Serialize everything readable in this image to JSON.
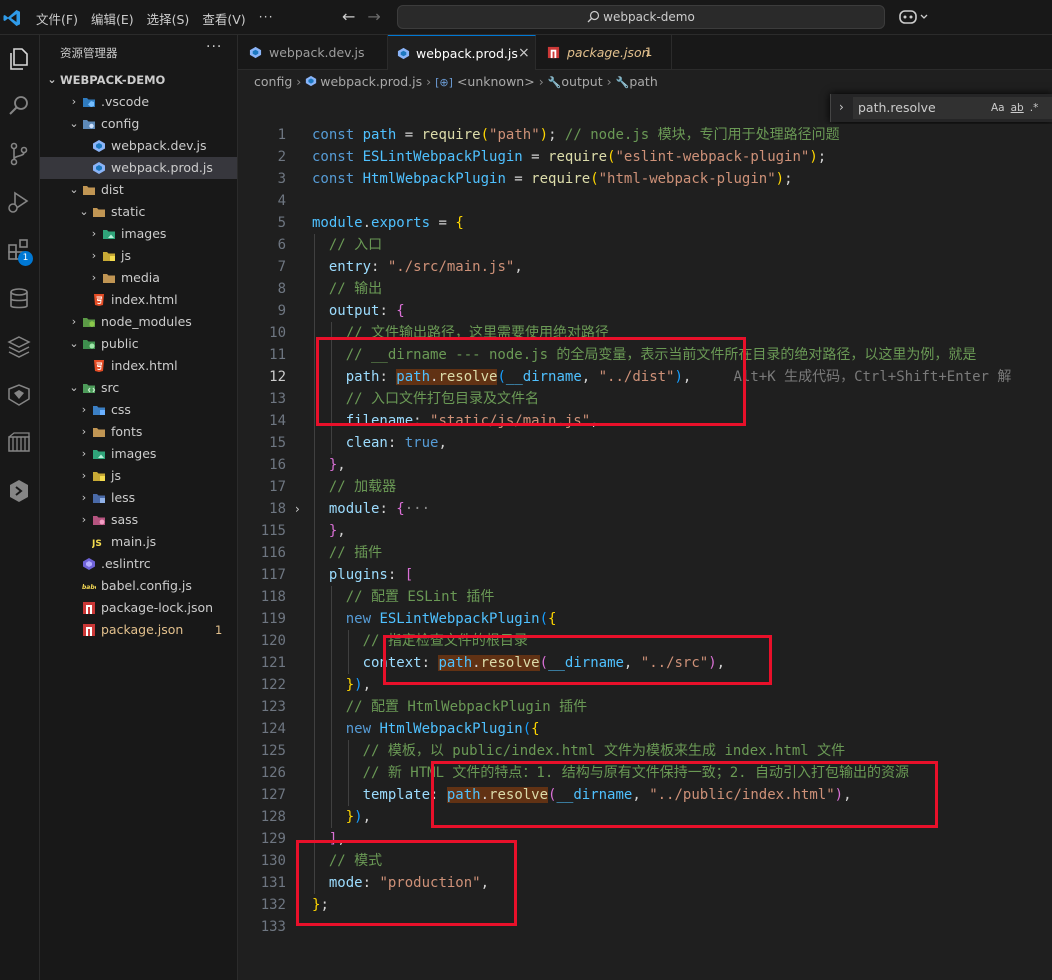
{
  "titlebar": {
    "menu": [
      "文件(F)",
      "编辑(E)",
      "选择(S)",
      "查看(V)"
    ],
    "more": "···",
    "search": "webpack-demo"
  },
  "sidebar": {
    "title": "资源管理器",
    "more": "···",
    "root": "WEBPACK-DEMO",
    "items": [
      {
        "label": ".vscode",
        "depth": 1,
        "chev": "›",
        "icon": "vscode-folder-icon"
      },
      {
        "label": "config",
        "depth": 1,
        "chev": "⌄",
        "icon": "config-folder-icon"
      },
      {
        "label": "webpack.dev.js",
        "depth": 2,
        "chev": "",
        "icon": "webpack-icon"
      },
      {
        "label": "webpack.prod.js",
        "depth": 2,
        "chev": "",
        "icon": "webpack-icon",
        "selected": true
      },
      {
        "label": "dist",
        "depth": 1,
        "chev": "⌄",
        "icon": "folder-icon"
      },
      {
        "label": "static",
        "depth": 2,
        "chev": "⌄",
        "icon": "folder-icon"
      },
      {
        "label": "images",
        "depth": 3,
        "chev": "›",
        "icon": "images-folder-icon"
      },
      {
        "label": "js",
        "depth": 3,
        "chev": "›",
        "icon": "js-folder-icon"
      },
      {
        "label": "media",
        "depth": 3,
        "chev": "›",
        "icon": "folder-icon"
      },
      {
        "label": "index.html",
        "depth": 2,
        "chev": "",
        "icon": "html-icon"
      },
      {
        "label": "node_modules",
        "depth": 1,
        "chev": "›",
        "icon": "node-folder-icon"
      },
      {
        "label": "public",
        "depth": 1,
        "chev": "⌄",
        "icon": "public-folder-icon"
      },
      {
        "label": "index.html",
        "depth": 2,
        "chev": "",
        "icon": "html-icon"
      },
      {
        "label": "src",
        "depth": 1,
        "chev": "⌄",
        "icon": "src-folder-icon"
      },
      {
        "label": "css",
        "depth": 2,
        "chev": "›",
        "icon": "css-folder-icon"
      },
      {
        "label": "fonts",
        "depth": 2,
        "chev": "›",
        "icon": "folder-icon"
      },
      {
        "label": "images",
        "depth": 2,
        "chev": "›",
        "icon": "images-folder-icon"
      },
      {
        "label": "js",
        "depth": 2,
        "chev": "›",
        "icon": "js-folder-icon"
      },
      {
        "label": "less",
        "depth": 2,
        "chev": "›",
        "icon": "less-folder-icon"
      },
      {
        "label": "sass",
        "depth": 2,
        "chev": "›",
        "icon": "sass-folder-icon"
      },
      {
        "label": "main.js",
        "depth": 2,
        "chev": "",
        "icon": "js-file-icon"
      },
      {
        "label": ".eslintrc",
        "depth": 1,
        "chev": "",
        "icon": "eslint-icon"
      },
      {
        "label": "babel.config.js",
        "depth": 1,
        "chev": "",
        "icon": "babel-icon"
      },
      {
        "label": "package-lock.json",
        "depth": 1,
        "chev": "",
        "icon": "npm-icon"
      },
      {
        "label": "package.json",
        "depth": 1,
        "chev": "",
        "icon": "npm-icon",
        "modified": true,
        "count": "1"
      }
    ]
  },
  "tabs": [
    {
      "label": "webpack.dev.js",
      "active": false
    },
    {
      "label": "webpack.prod.js",
      "active": true,
      "close": "×"
    },
    {
      "label": "package.json",
      "active": false,
      "modified": true,
      "count": "1"
    }
  ],
  "breadcrumb": [
    "config",
    "webpack.prod.js",
    "<unknown>",
    "output",
    "path"
  ],
  "find": {
    "value": "path.resolve",
    "options": [
      "Aa",
      "ab",
      ".*"
    ]
  },
  "code": [
    {
      "n": "1",
      "t": [
        [
          "kw",
          "const "
        ],
        [
          "var",
          "path"
        ],
        [
          "op",
          " = "
        ],
        [
          "fn",
          "require"
        ],
        [
          "br1",
          "("
        ],
        [
          "str",
          "\"path\""
        ],
        [
          "br1",
          ")"
        ],
        [
          "op",
          "; "
        ],
        [
          "cm",
          "// node.js 模块，专门用于处理路径问题"
        ]
      ]
    },
    {
      "n": "2",
      "t": [
        [
          "kw",
          "const "
        ],
        [
          "var",
          "ESLintWebpackPlugin"
        ],
        [
          "op",
          " = "
        ],
        [
          "fn",
          "require"
        ],
        [
          "br1",
          "("
        ],
        [
          "str",
          "\"eslint-webpack-plugin\""
        ],
        [
          "br1",
          ")"
        ],
        [
          "op",
          ";"
        ]
      ]
    },
    {
      "n": "3",
      "t": [
        [
          "kw",
          "const "
        ],
        [
          "var",
          "HtmlWebpackPlugin"
        ],
        [
          "op",
          " = "
        ],
        [
          "fn",
          "require"
        ],
        [
          "br1",
          "("
        ],
        [
          "str",
          "\"html-webpack-plugin\""
        ],
        [
          "br1",
          ")"
        ],
        [
          "op",
          ";"
        ]
      ]
    },
    {
      "n": "4",
      "t": []
    },
    {
      "n": "5",
      "t": [
        [
          "var",
          "module"
        ],
        [
          "op",
          "."
        ],
        [
          "var",
          "exports"
        ],
        [
          "op",
          " = "
        ],
        [
          "br1",
          "{"
        ]
      ]
    },
    {
      "n": "6",
      "t": [
        [
          "op",
          "  "
        ],
        [
          "cm",
          "// 入口"
        ]
      ]
    },
    {
      "n": "7",
      "t": [
        [
          "op",
          "  "
        ],
        [
          "prop",
          "entry"
        ],
        [
          "op",
          ": "
        ],
        [
          "str",
          "\"./src/main.js\""
        ],
        [
          "op",
          ","
        ]
      ]
    },
    {
      "n": "8",
      "t": [
        [
          "op",
          "  "
        ],
        [
          "cm",
          "// 输出"
        ]
      ]
    },
    {
      "n": "9",
      "t": [
        [
          "op",
          "  "
        ],
        [
          "prop",
          "output"
        ],
        [
          "op",
          ": "
        ],
        [
          "br2",
          "{"
        ]
      ]
    },
    {
      "n": "10",
      "t": [
        [
          "op",
          "    "
        ],
        [
          "cm",
          "// 文件输出路径，这里需要使用绝对路径"
        ]
      ]
    },
    {
      "n": "11",
      "t": [
        [
          "op",
          "    "
        ],
        [
          "cm",
          "// __dirname --- node.js 的全局变量，表示当前文件所在目录的绝对路径，以这里为例，就是"
        ]
      ]
    },
    {
      "n": "12",
      "cur": true,
      "t": [
        [
          "op",
          "    "
        ],
        [
          "prop",
          "path"
        ],
        [
          "op",
          ": "
        ],
        [
          "hlvar",
          "path"
        ],
        [
          "hlop",
          "."
        ],
        [
          "hlfn",
          "resolve"
        ],
        [
          "br3",
          "("
        ],
        [
          "var",
          "__dirname"
        ],
        [
          "op",
          ", "
        ],
        [
          "str",
          "\"../dist\""
        ],
        [
          "br3",
          ")"
        ],
        [
          "op",
          ","
        ],
        [
          "hint",
          "     Alt+K 生成代码，Ctrl+Shift+Enter 解"
        ]
      ]
    },
    {
      "n": "13",
      "t": [
        [
          "op",
          "    "
        ],
        [
          "cm",
          "// 入口文件打包目录及文件名"
        ]
      ]
    },
    {
      "n": "14",
      "t": [
        [
          "op",
          "    "
        ],
        [
          "prop",
          "filename"
        ],
        [
          "op",
          ": "
        ],
        [
          "str",
          "\"static/js/main.js\""
        ],
        [
          "op",
          ","
        ]
      ]
    },
    {
      "n": "15",
      "t": [
        [
          "op",
          "    "
        ],
        [
          "prop",
          "clean"
        ],
        [
          "op",
          ": "
        ],
        [
          "kw",
          "true"
        ],
        [
          "op",
          ","
        ]
      ]
    },
    {
      "n": "16",
      "t": [
        [
          "op",
          "  "
        ],
        [
          "br2",
          "}"
        ],
        [
          "op",
          ","
        ]
      ]
    },
    {
      "n": "17",
      "t": [
        [
          "op",
          "  "
        ],
        [
          "cm",
          "// 加载器"
        ]
      ]
    },
    {
      "n": "18",
      "fold": true,
      "t": [
        [
          "op",
          "  "
        ],
        [
          "prop",
          "module"
        ],
        [
          "op",
          ": "
        ],
        [
          "br2",
          "{"
        ],
        [
          "ghost",
          "···"
        ]
      ]
    },
    {
      "n": "115",
      "t": [
        [
          "op",
          "  "
        ],
        [
          "br2",
          "}"
        ],
        [
          "op",
          ","
        ]
      ]
    },
    {
      "n": "116",
      "t": [
        [
          "op",
          "  "
        ],
        [
          "cm",
          "// 插件"
        ]
      ]
    },
    {
      "n": "117",
      "t": [
        [
          "op",
          "  "
        ],
        [
          "prop",
          "plugins"
        ],
        [
          "op",
          ": "
        ],
        [
          "br2",
          "["
        ]
      ]
    },
    {
      "n": "118",
      "t": [
        [
          "op",
          "    "
        ],
        [
          "cm",
          "// 配置 ESLint 插件"
        ]
      ]
    },
    {
      "n": "119",
      "t": [
        [
          "op",
          "    "
        ],
        [
          "kw",
          "new "
        ],
        [
          "var",
          "ESLintWebpackPlugin"
        ],
        [
          "br3",
          "("
        ],
        [
          "br1",
          "{"
        ]
      ]
    },
    {
      "n": "120",
      "t": [
        [
          "op",
          "      "
        ],
        [
          "cm",
          "// 指定检查文件的根目录"
        ]
      ]
    },
    {
      "n": "121",
      "t": [
        [
          "op",
          "      "
        ],
        [
          "prop",
          "context"
        ],
        [
          "op",
          ": "
        ],
        [
          "hlvar",
          "path"
        ],
        [
          "hlop",
          "."
        ],
        [
          "hlfn",
          "resolve"
        ],
        [
          "br2",
          "("
        ],
        [
          "var",
          "__dirname"
        ],
        [
          "op",
          ", "
        ],
        [
          "str",
          "\"../src\""
        ],
        [
          "br2",
          ")"
        ],
        [
          "op",
          ","
        ]
      ]
    },
    {
      "n": "122",
      "t": [
        [
          "op",
          "    "
        ],
        [
          "br1",
          "}"
        ],
        [
          "br3",
          ")"
        ],
        [
          "op",
          ","
        ]
      ]
    },
    {
      "n": "123",
      "t": [
        [
          "op",
          "    "
        ],
        [
          "cm",
          "// 配置 HtmlWebpackPlugin 插件"
        ]
      ]
    },
    {
      "n": "124",
      "t": [
        [
          "op",
          "    "
        ],
        [
          "kw",
          "new "
        ],
        [
          "var",
          "HtmlWebpackPlugin"
        ],
        [
          "br3",
          "("
        ],
        [
          "br1",
          "{"
        ]
      ]
    },
    {
      "n": "125",
      "t": [
        [
          "op",
          "      "
        ],
        [
          "cm",
          "// 模板，以 public/index.html 文件为模板来生成 index.html 文件"
        ]
      ]
    },
    {
      "n": "126",
      "t": [
        [
          "op",
          "      "
        ],
        [
          "cm",
          "// 新 HTML 文件的特点：1. 结构与原有文件保持一致；2. 自动引入打包输出的资源"
        ]
      ]
    },
    {
      "n": "127",
      "t": [
        [
          "op",
          "      "
        ],
        [
          "prop",
          "template"
        ],
        [
          "op",
          ": "
        ],
        [
          "hlvar",
          "path"
        ],
        [
          "hlop",
          "."
        ],
        [
          "hlfn",
          "resolve"
        ],
        [
          "br2",
          "("
        ],
        [
          "var",
          "__dirname"
        ],
        [
          "op",
          ", "
        ],
        [
          "str",
          "\"../public/index.html\""
        ],
        [
          "br2",
          ")"
        ],
        [
          "op",
          ","
        ]
      ]
    },
    {
      "n": "128",
      "t": [
        [
          "op",
          "    "
        ],
        [
          "br1",
          "}"
        ],
        [
          "br3",
          ")"
        ],
        [
          "op",
          ","
        ]
      ]
    },
    {
      "n": "129",
      "t": [
        [
          "op",
          "  "
        ],
        [
          "br2",
          "]"
        ],
        [
          "op",
          ","
        ]
      ]
    },
    {
      "n": "130",
      "t": [
        [
          "op",
          "  "
        ],
        [
          "cm",
          "// 模式"
        ]
      ]
    },
    {
      "n": "131",
      "t": [
        [
          "op",
          "  "
        ],
        [
          "prop",
          "mode"
        ],
        [
          "op",
          ": "
        ],
        [
          "str",
          "\"production\""
        ],
        [
          "op",
          ","
        ]
      ]
    },
    {
      "n": "132",
      "t": [
        [
          "br1",
          "}"
        ],
        [
          "op",
          ";"
        ]
      ]
    },
    {
      "n": "133",
      "t": []
    }
  ],
  "colors": {
    "accent": "#0078d4",
    "annotation_red": "#e8102a",
    "find_highlight": "#613214"
  }
}
